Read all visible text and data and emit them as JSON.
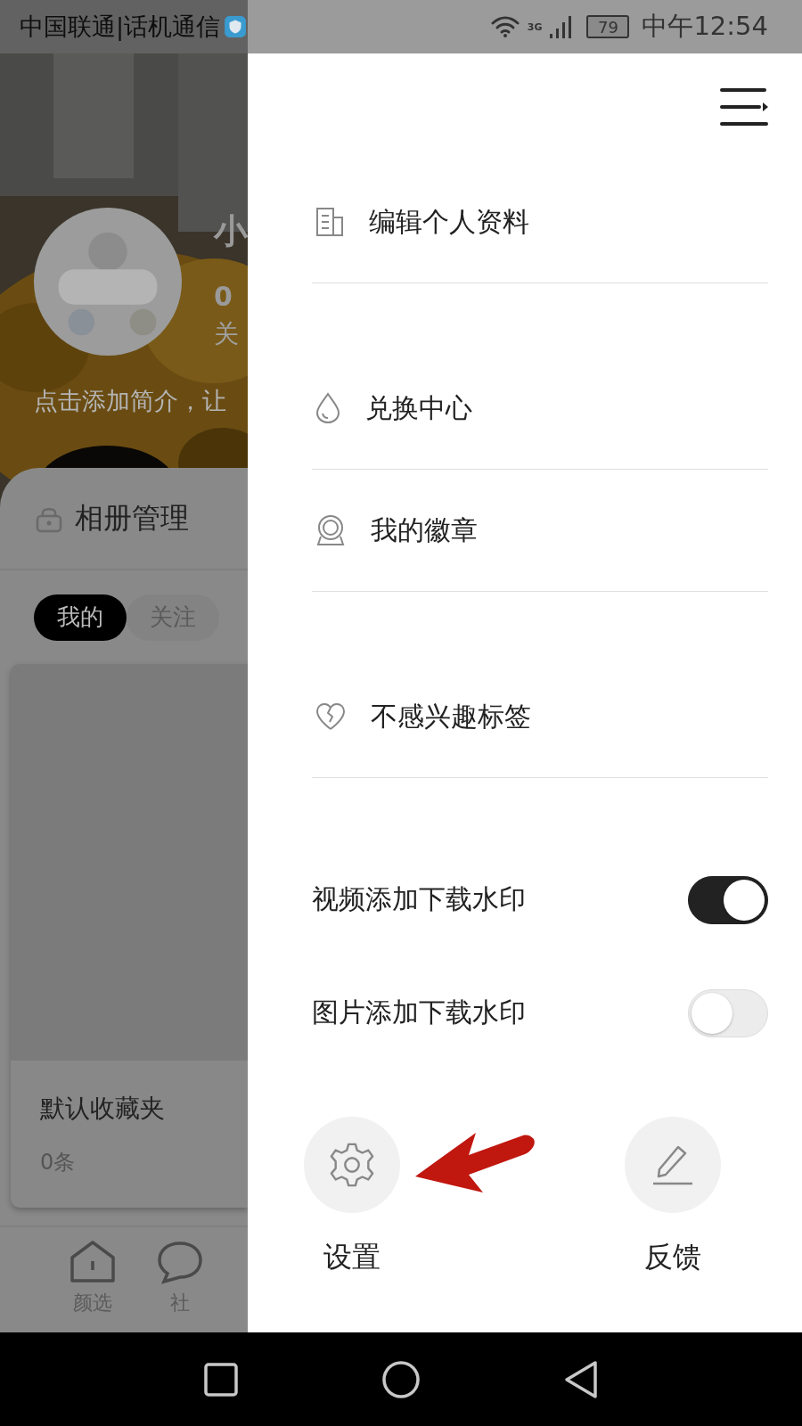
{
  "status_bar": {
    "carrier": "中国联通|话机通信",
    "network": "3G",
    "battery": "79",
    "time": "中午12:54"
  },
  "profile": {
    "name": "小",
    "count": "0",
    "follow_label": "关",
    "bio": "点击添加简介，让"
  },
  "album_header": {
    "label": "相册管理"
  },
  "tabs": [
    {
      "label": "我的",
      "selected": true
    },
    {
      "label": "关注",
      "selected": false
    }
  ],
  "folder": {
    "title": "默认收藏夹",
    "count": "0条"
  },
  "bottom_nav": [
    {
      "label": "颜选"
    },
    {
      "label": "社"
    }
  ],
  "drawer": {
    "menu": [
      {
        "label": "编辑个人资料"
      },
      {
        "label": "兑换中心"
      },
      {
        "label": "我的徽章"
      },
      {
        "label": "不感兴趣标签"
      }
    ],
    "toggles": [
      {
        "label": "视频添加下载水印",
        "on": true
      },
      {
        "label": "图片添加下载水印",
        "on": false
      }
    ],
    "actions": [
      {
        "label": "设置"
      },
      {
        "label": "反馈"
      }
    ]
  }
}
